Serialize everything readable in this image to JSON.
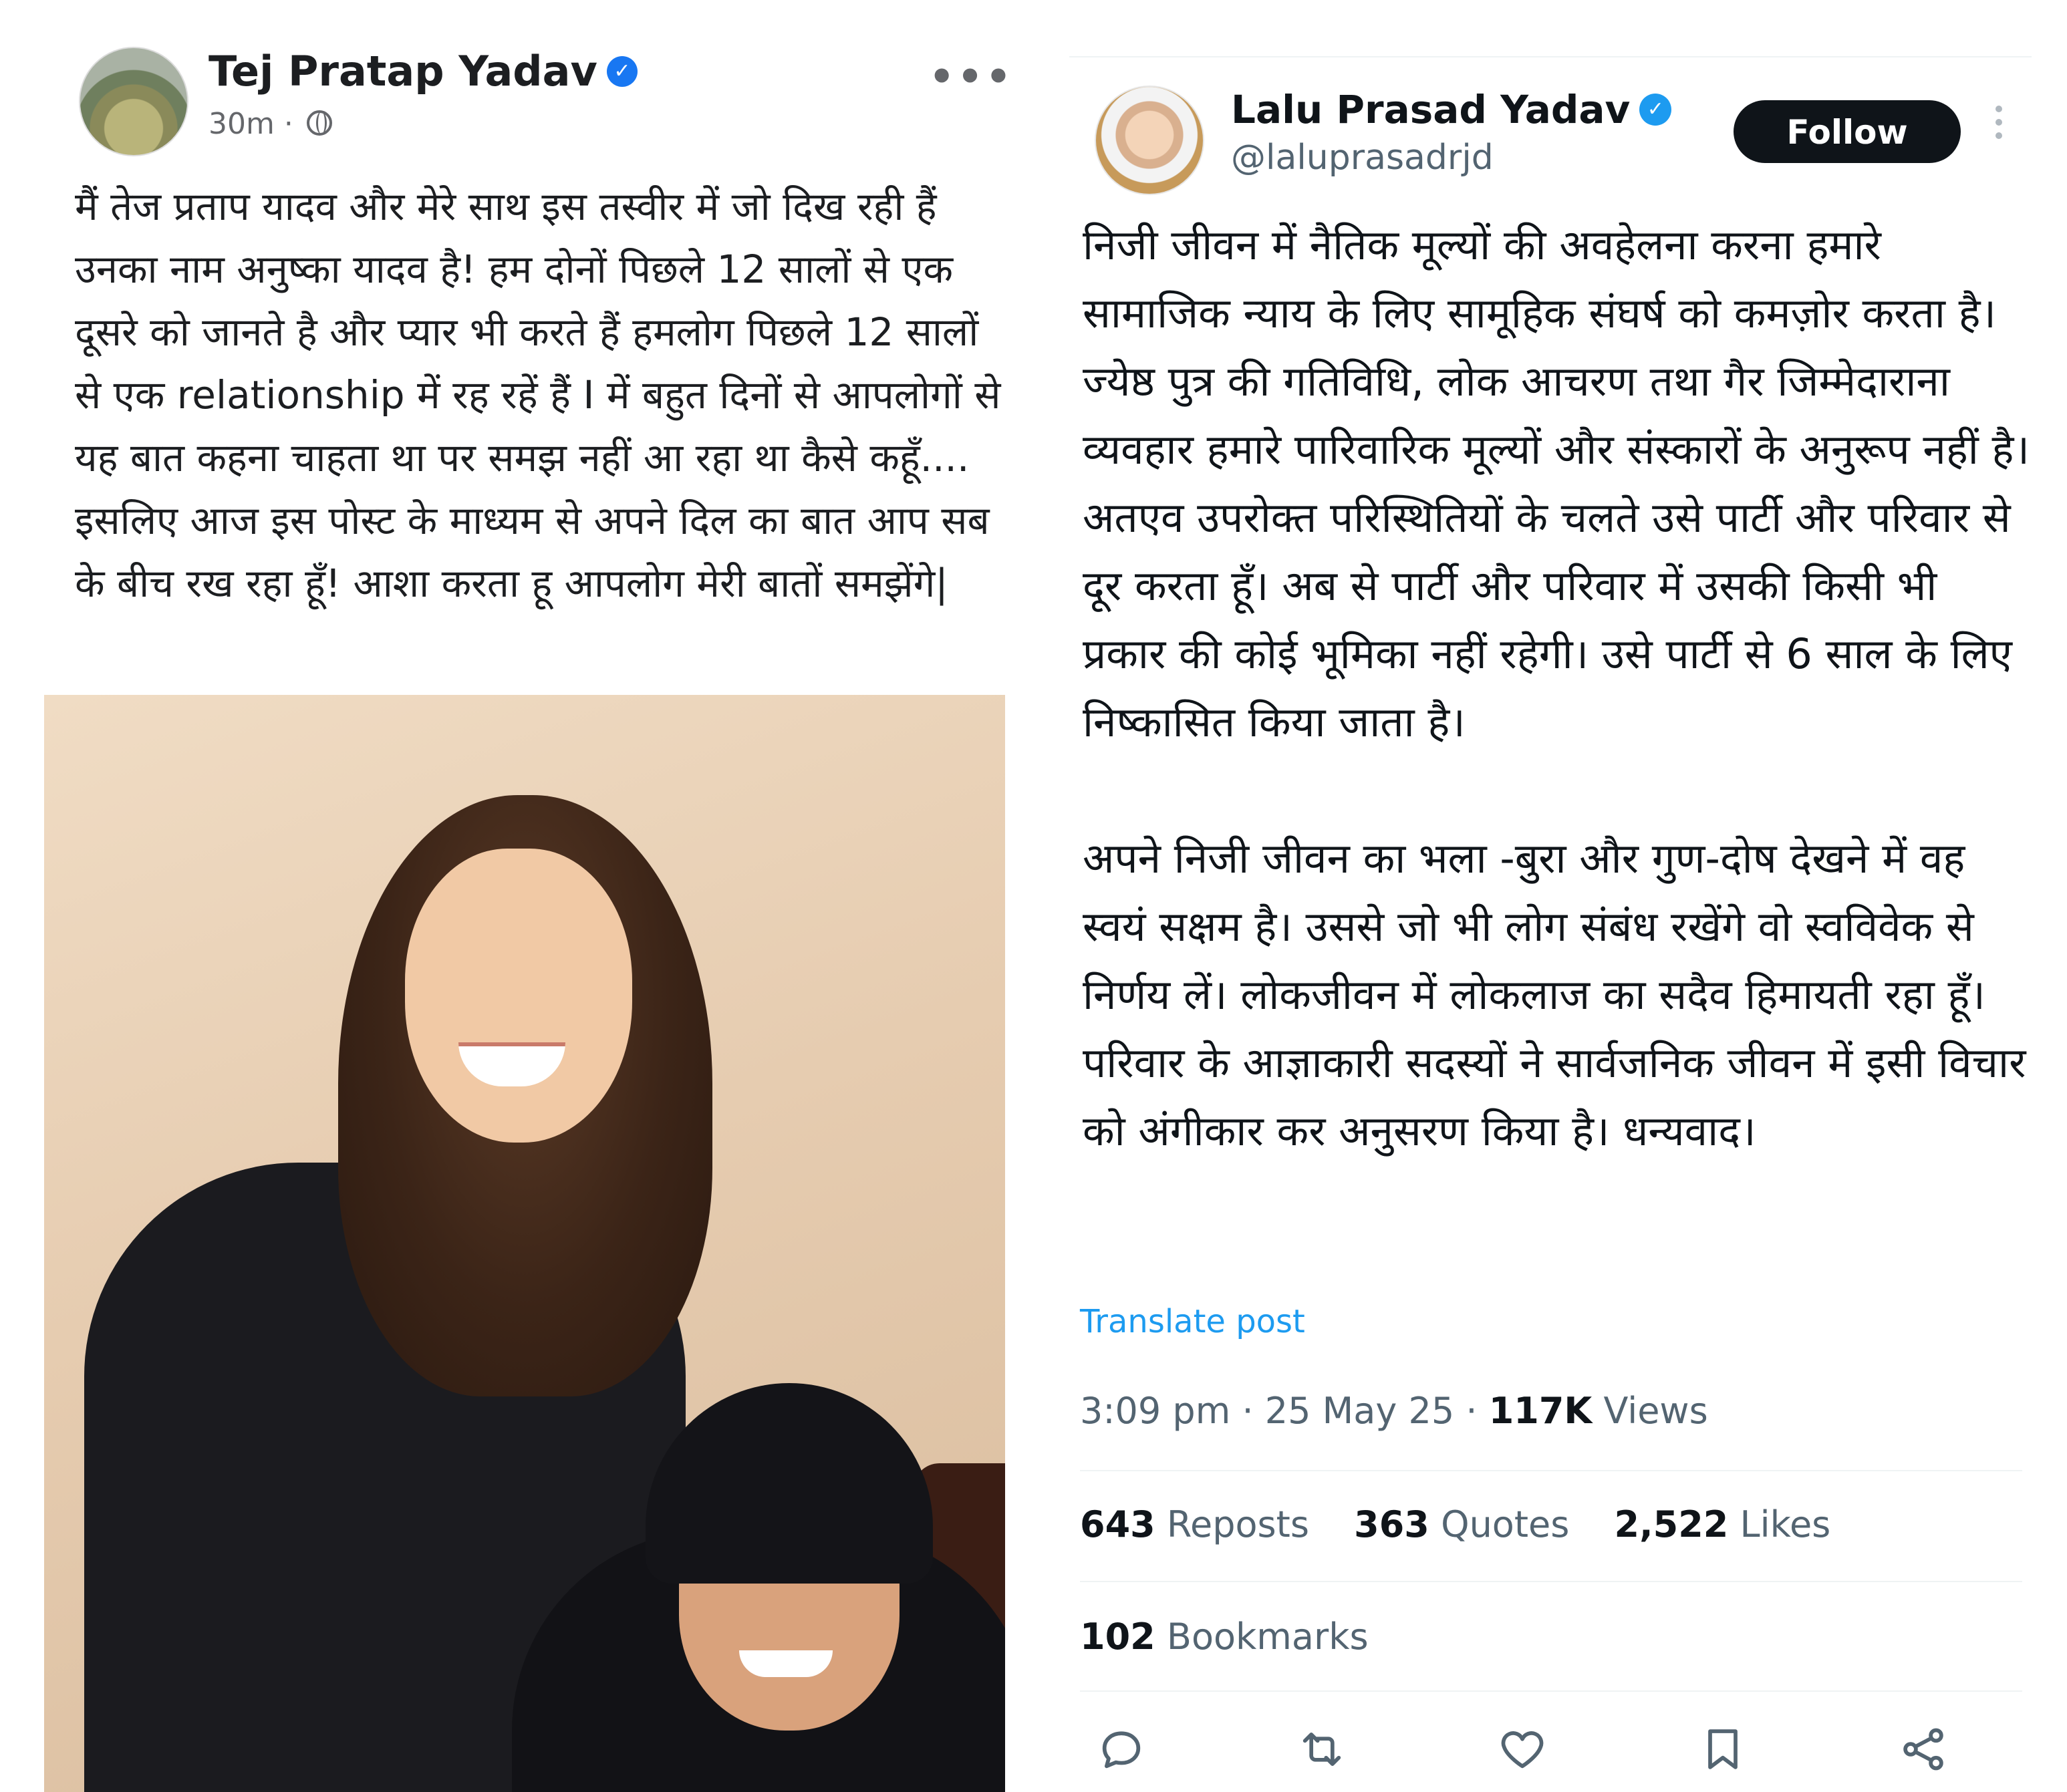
{
  "facebook_post": {
    "author": "Tej Pratap Yadav",
    "time": "30m ·",
    "more_label": "•••",
    "text": "मैं तेज प्रताप यादव और  मेरे साथ इस तस्वीर में जो दिख रही हैं उनका नाम अनुष्का यादव है! हम दोनों पिछले 12 सालों से एक दूसरे को जानते है और प्यार भी करते हैं हमलोग पिछले 12 सालों से एक relationship में रह रहें हैं I में बहुत दिनों से आपलोगों से यह बात कहना चाहता था पर समझ नहीं आ रहा था कैसे कहूँ.... इसलिए आज इस पोस्ट के माध्यम से अपने दिल का बात आप सब के बीच रख रहा हूँ! आशा करता हू आपलोग मेरी बातों समझेंगे|",
    "verified_color": "#1877f2"
  },
  "x_post": {
    "author": "Lalu Prasad Yadav",
    "handle": "@laluprasadrjd",
    "follow_label": "Follow",
    "paragraph_1": "निजी जीवन में नैतिक मूल्यों की अवहेलना करना हमारे सामाजिक न्याय के लिए सामूहिक संघर्ष को कमज़ोर करता है। ज्येष्ठ पुत्र की गतिविधि, लोक आचरण तथा गैर जिम्मेदाराना व्यवहार हमारे पारिवारिक मूल्यों और संस्कारों के अनुरूप नहीं है। अतएव उपरोक्त परिस्थितियों के चलते उसे पार्टी और परिवार से दूर करता हूँ। अब से पार्टी और परिवार में उसकी किसी भी प्रकार की कोई भूमिका नहीं रहेगी। उसे पार्टी से 6 साल के लिए निष्कासित किया जाता है।",
    "paragraph_2": "अपने निजी जीवन का भला -बुरा और गुण-दोष देखने में वह स्वयं सक्षम है। उससे जो भी लोग संबंध रखेंगे वो स्वविवेक से निर्णय लें। लोकजीवन में लोकलाज का सदैव हिमायती रहा हूँ। परिवार के आज्ञाकारी सदस्यों ने सार्वजनिक जीवन में इसी विचार को अंगीकार कर अनुसरण किया है। धन्यवाद।",
    "translate_label": "Translate post",
    "timestamp": "3:09 pm · 25 May 25 ·",
    "views_count": "117K",
    "views_label": "Views",
    "reposts_count": "643",
    "reposts_label": "Reposts",
    "quotes_count": "363",
    "quotes_label": "Quotes",
    "likes_count": "2,522",
    "likes_label": "Likes",
    "bookmarks_count": "102",
    "bookmarks_label": "Bookmarks",
    "actions": [
      "reply-icon",
      "repost-icon",
      "like-icon",
      "bookmark-icon",
      "share-icon"
    ],
    "accent_color": "#1d9bf0"
  }
}
